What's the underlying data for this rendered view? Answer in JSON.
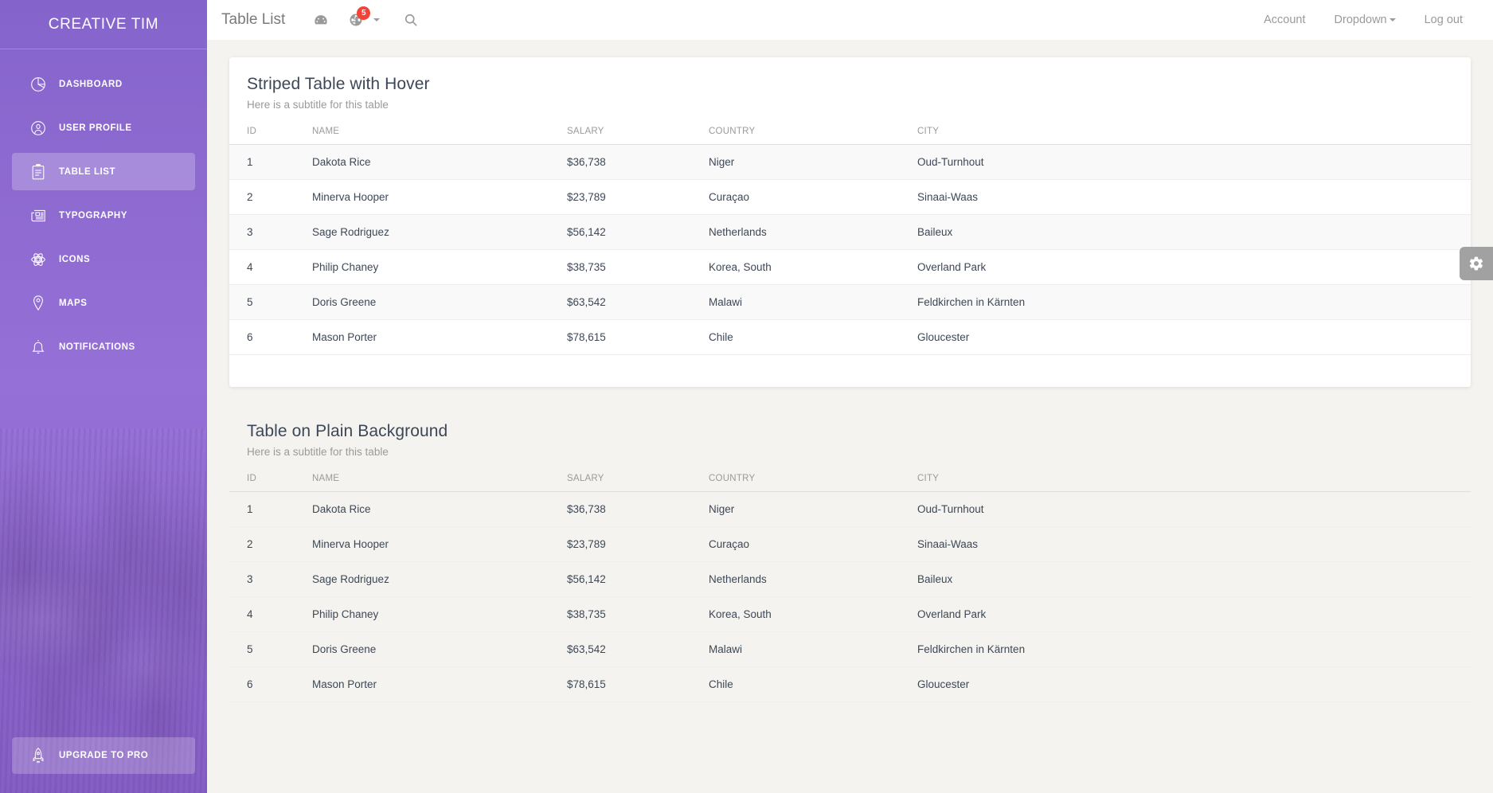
{
  "sidebar": {
    "brand": "CREATIVE TIM",
    "items": [
      {
        "label": "DASHBOARD",
        "icon": "pie-chart-icon",
        "active": false
      },
      {
        "label": "USER PROFILE",
        "icon": "user-icon",
        "active": false
      },
      {
        "label": "TABLE LIST",
        "icon": "clipboard-icon",
        "active": true
      },
      {
        "label": "TYPOGRAPHY",
        "icon": "newspaper-icon",
        "active": false
      },
      {
        "label": "ICONS",
        "icon": "atom-icon",
        "active": false
      },
      {
        "label": "MAPS",
        "icon": "map-pin-icon",
        "active": false
      },
      {
        "label": "NOTIFICATIONS",
        "icon": "bell-icon",
        "active": false
      }
    ],
    "upgrade": {
      "label": "UPGRADE TO PRO",
      "icon": "rocket-icon"
    }
  },
  "topbar": {
    "title": "Table List",
    "dashboard_icon": "speedometer-icon",
    "notifications_icon": "globe-icon",
    "notifications_badge": "5",
    "search_icon": "search-icon",
    "links": [
      {
        "label": "Account",
        "caret": false
      },
      {
        "label": "Dropdown",
        "caret": true
      },
      {
        "label": "Log out",
        "caret": false
      }
    ]
  },
  "floating": {
    "icon": "gear-icon",
    "label": "Settings"
  },
  "columns": [
    "ID",
    "NAME",
    "SALARY",
    "COUNTRY",
    "CITY"
  ],
  "cards": [
    {
      "title": "Striped Table with Hover",
      "subtitle": "Here is a subtitle for this table",
      "style": "striped",
      "rows": [
        [
          "1",
          "Dakota Rice",
          "$36,738",
          "Niger",
          "Oud-Turnhout"
        ],
        [
          "2",
          "Minerva Hooper",
          "$23,789",
          "Curaçao",
          "Sinaai-Waas"
        ],
        [
          "3",
          "Sage Rodriguez",
          "$56,142",
          "Netherlands",
          "Baileux"
        ],
        [
          "4",
          "Philip Chaney",
          "$38,735",
          "Korea, South",
          "Overland Park"
        ],
        [
          "5",
          "Doris Greene",
          "$63,542",
          "Malawi",
          "Feldkirchen in Kärnten"
        ],
        [
          "6",
          "Mason Porter",
          "$78,615",
          "Chile",
          "Gloucester"
        ]
      ]
    },
    {
      "title": "Table on Plain Background",
      "subtitle": "Here is a subtitle for this table",
      "style": "plain",
      "rows": [
        [
          "1",
          "Dakota Rice",
          "$36,738",
          "Niger",
          "Oud-Turnhout"
        ],
        [
          "2",
          "Minerva Hooper",
          "$23,789",
          "Curaçao",
          "Sinaai-Waas"
        ],
        [
          "3",
          "Sage Rodriguez",
          "$56,142",
          "Netherlands",
          "Baileux"
        ],
        [
          "4",
          "Philip Chaney",
          "$38,735",
          "Korea, South",
          "Overland Park"
        ],
        [
          "5",
          "Doris Greene",
          "$63,542",
          "Malawi",
          "Feldkirchen in Kärnten"
        ],
        [
          "6",
          "Mason Porter",
          "$78,615",
          "Chile",
          "Gloucester"
        ]
      ]
    }
  ],
  "colors": {
    "sidebar_purple": "#8d6ad0",
    "page_background": "#f4f3ef",
    "badge_red": "#f44336",
    "text_dark": "#3c4858",
    "text_muted": "#9a9a9a"
  }
}
